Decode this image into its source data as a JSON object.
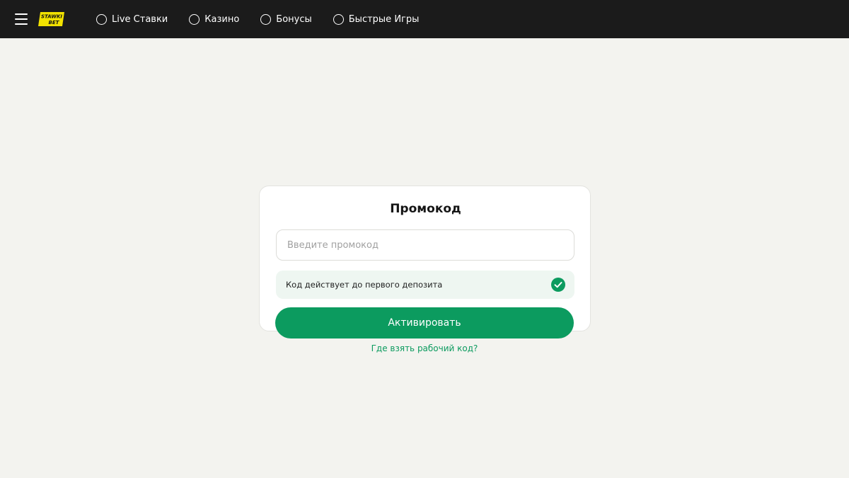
{
  "header": {
    "menu_icon": "hamburger-icon",
    "logo": {
      "line1": "STAWKI",
      "line2": "BET",
      "color": "#f2e200"
    },
    "nav": [
      {
        "label": "Live Ставки",
        "icon": "circle-icon"
      },
      {
        "label": "Казино",
        "icon": "circle-icon"
      },
      {
        "label": "Бонусы",
        "icon": "circle-icon"
      },
      {
        "label": "Быстрые Игры",
        "icon": "circle-icon"
      }
    ]
  },
  "promo": {
    "title": "Промокод",
    "input_value": "",
    "input_placeholder": "Введите промокод",
    "info_text": "Код действует до первого депозита",
    "info_icon": "check-circle-icon",
    "activate_label": "Активировать",
    "help_link": "Где взять рабочий код?"
  },
  "colors": {
    "accent": "#0c9b5f",
    "header_bg": "#1b1b1b",
    "page_bg": "#f3f3ef",
    "info_bg": "#eef6f1"
  }
}
